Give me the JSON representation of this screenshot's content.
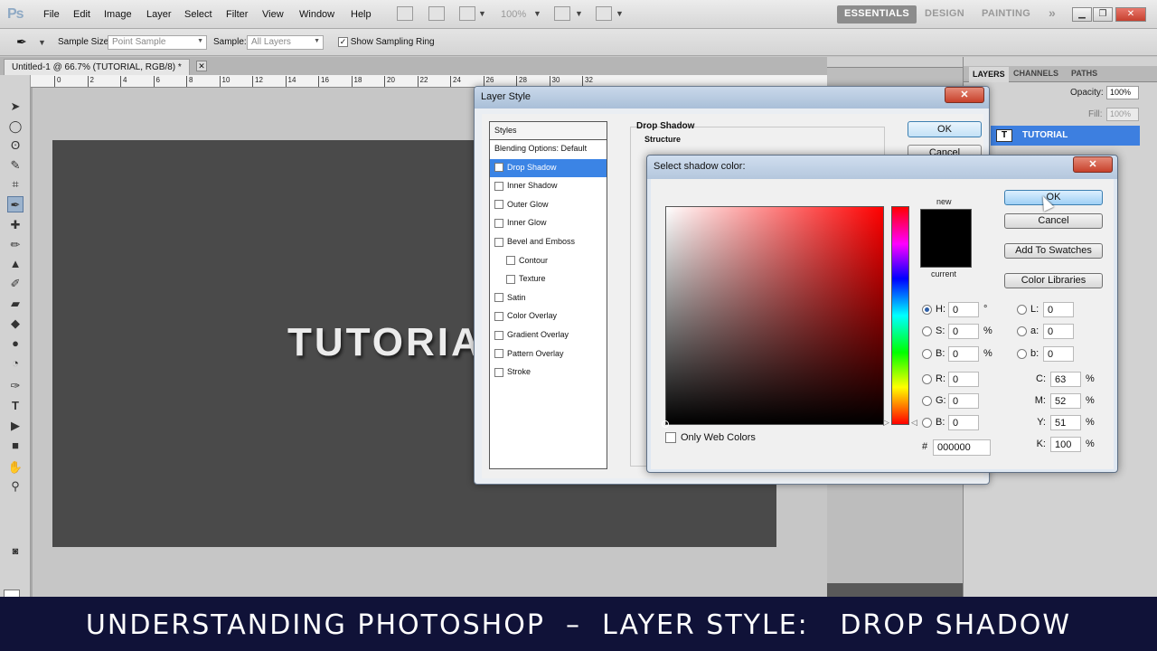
{
  "app": {
    "logo": "Ps"
  },
  "menubar": {
    "items": [
      "File",
      "Edit",
      "Image",
      "Layer",
      "Select",
      "Filter",
      "View",
      "Window",
      "Help"
    ],
    "zoom": "100%",
    "workspaces": [
      "ESSENTIALS",
      "DESIGN",
      "PAINTING"
    ],
    "more": "»"
  },
  "options": {
    "sample_size_label": "Sample Size:",
    "sample_size_value": "Point Sample",
    "sample_label": "Sample:",
    "sample_value": "All Layers",
    "show_ring_label": "Show Sampling Ring",
    "show_ring_checked": true
  },
  "document": {
    "tab_title": "Untitled-1 @ 66.7% (TUTORIAL, RGB/8) *",
    "canvas_text": "TUTORIAL",
    "ruler_ticks": [
      "0",
      "2",
      "4",
      "6",
      "8",
      "10",
      "12",
      "14",
      "16",
      "18",
      "20",
      "22",
      "24",
      "26",
      "28",
      "30",
      "32"
    ]
  },
  "layers_panel": {
    "tabs": [
      "LAYERS",
      "CHANNELS",
      "PATHS"
    ],
    "opacity_label": "Opacity:",
    "opacity_value": "100%",
    "fill_label": "Fill:",
    "fill_value": "100%",
    "layer_name": "TUTORIAL",
    "layer_type_glyph": "T"
  },
  "layer_style": {
    "title": "Layer Style",
    "styles_header": "Styles",
    "items": [
      {
        "label": "Blending Options: Default",
        "check": false,
        "selected": false,
        "sub": false,
        "nocheck": true
      },
      {
        "label": "Drop Shadow",
        "check": true,
        "selected": true,
        "sub": false
      },
      {
        "label": "Inner Shadow",
        "check": false,
        "selected": false,
        "sub": false
      },
      {
        "label": "Outer Glow",
        "check": false,
        "selected": false,
        "sub": false
      },
      {
        "label": "Inner Glow",
        "check": false,
        "selected": false,
        "sub": false
      },
      {
        "label": "Bevel and Emboss",
        "check": false,
        "selected": false,
        "sub": false
      },
      {
        "label": "Contour",
        "check": false,
        "selected": false,
        "sub": true
      },
      {
        "label": "Texture",
        "check": false,
        "selected": false,
        "sub": true
      },
      {
        "label": "Satin",
        "check": false,
        "selected": false,
        "sub": false
      },
      {
        "label": "Color Overlay",
        "check": false,
        "selected": false,
        "sub": false
      },
      {
        "label": "Gradient Overlay",
        "check": false,
        "selected": false,
        "sub": false
      },
      {
        "label": "Pattern Overlay",
        "check": false,
        "selected": false,
        "sub": false
      },
      {
        "label": "Stroke",
        "check": false,
        "selected": false,
        "sub": false
      }
    ],
    "section_title": "Drop Shadow",
    "structure_title": "Structure",
    "ok_label": "OK",
    "cancel_label": "Cancel"
  },
  "color_picker": {
    "title": "Select shadow color:",
    "new_label": "new",
    "current_label": "current",
    "new_color": "#000000",
    "current_color": "#000000",
    "only_web_label": "Only Web Colors",
    "buttons": {
      "ok": "OK",
      "cancel": "Cancel",
      "add": "Add To Swatches",
      "libs": "Color Libraries"
    },
    "hsb": [
      {
        "label": "H:",
        "value": "0",
        "unit": "°",
        "on": true
      },
      {
        "label": "S:",
        "value": "0",
        "unit": "%",
        "on": false
      },
      {
        "label": "B:",
        "value": "0",
        "unit": "%",
        "on": false
      }
    ],
    "rgb": [
      {
        "label": "R:",
        "value": "0"
      },
      {
        "label": "G:",
        "value": "0"
      },
      {
        "label": "B:",
        "value": "0"
      }
    ],
    "lab": [
      {
        "label": "L:",
        "value": "0"
      },
      {
        "label": "a:",
        "value": "0"
      },
      {
        "label": "b:",
        "value": "0"
      }
    ],
    "cmyk": [
      {
        "label": "C:",
        "value": "63",
        "unit": "%"
      },
      {
        "label": "M:",
        "value": "52",
        "unit": "%"
      },
      {
        "label": "Y:",
        "value": "51",
        "unit": "%"
      },
      {
        "label": "K:",
        "value": "100",
        "unit": "%"
      }
    ],
    "hex_label": "#",
    "hex_value": "000000"
  },
  "banner": {
    "text": "UNDERSTANDING PHOTOSHOP  –  LAYER STYLE:   DROP SHADOW"
  }
}
